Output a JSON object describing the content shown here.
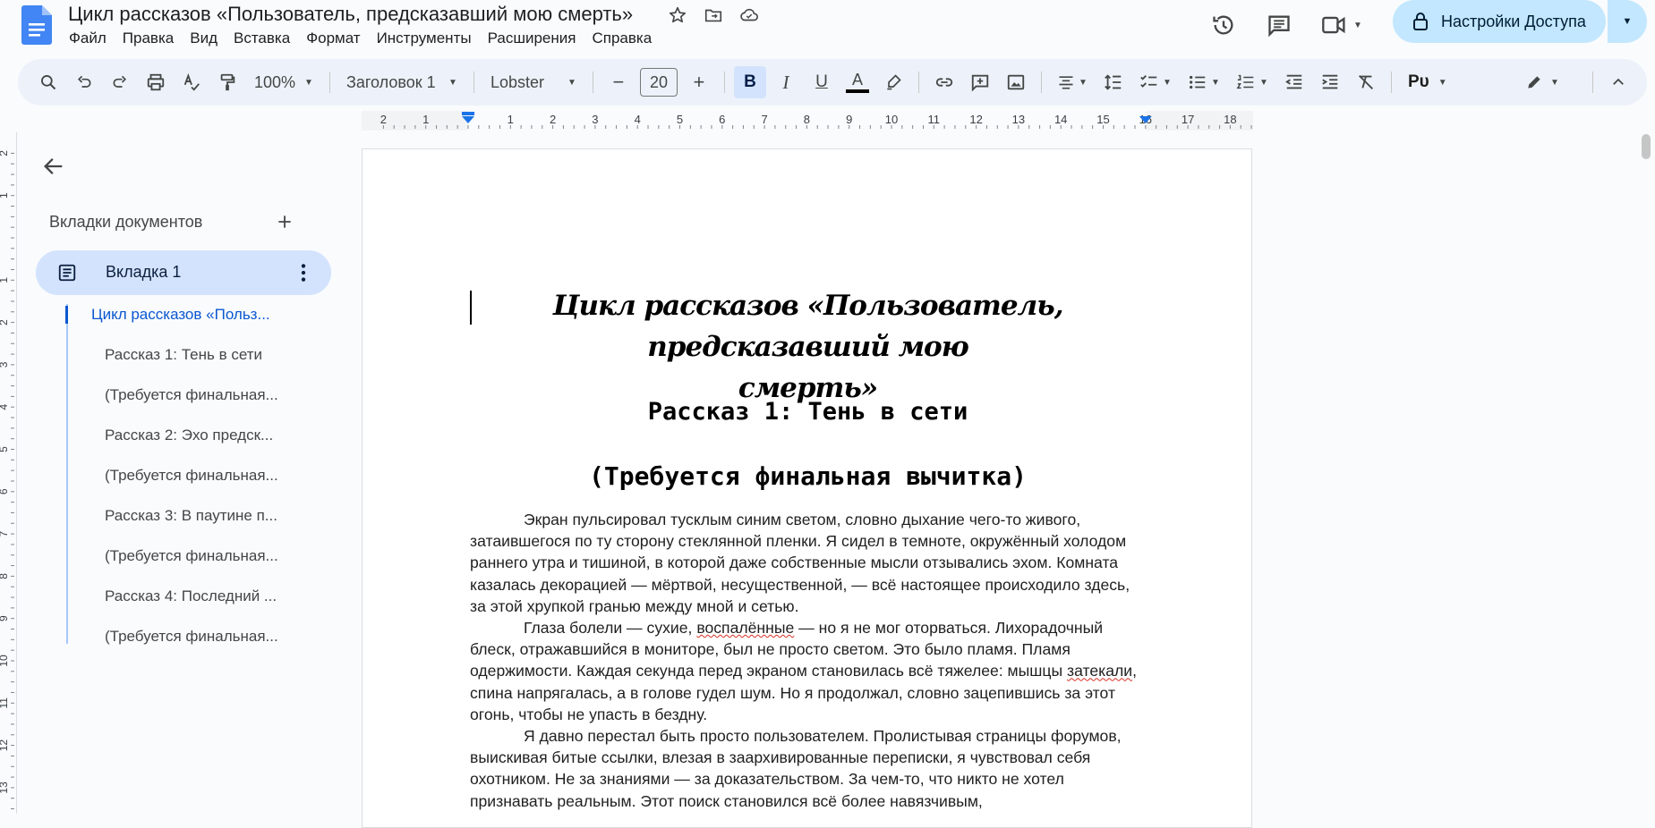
{
  "app": {
    "title": "Цикл рассказов «Пользователь, предсказавший мою смерть»"
  },
  "menu": [
    "Файл",
    "Правка",
    "Вид",
    "Вставка",
    "Формат",
    "Инструменты",
    "Расширения",
    "Справка"
  ],
  "share": {
    "label": "Настройки Доступа"
  },
  "toolbar": {
    "zoom": "100%",
    "style": "Заголовок 1",
    "font": "Lobster",
    "font_size": "20",
    "minus": "−",
    "plus": "+",
    "bold": "B",
    "italic": "I",
    "underline": "U",
    "text_color": "A",
    "input_tools": "Рᴜ"
  },
  "ruler": {
    "labels": [
      "2",
      "1",
      "1",
      "2",
      "3",
      "4",
      "5",
      "6",
      "7",
      "8",
      "9",
      "10",
      "11",
      "12",
      "13",
      "14",
      "15",
      "16",
      "17",
      "18"
    ],
    "vlabels": [
      "2",
      "1",
      "1",
      "2",
      "3",
      "4",
      "5",
      "6",
      "7",
      "8",
      "9",
      "10",
      "11",
      "12",
      "13"
    ]
  },
  "sidebar": {
    "heading": "Вкладки документов",
    "active_tab": "Вкладка 1",
    "outline": [
      "Цикл рассказов «Польз...",
      "Рассказ 1: Тень в сети",
      "(Требуется финальная...",
      "Рассказ 2: Эхо предск...",
      "(Требуется финальная...",
      "Рассказ 3: В паутине п...",
      "(Требуется финальная...",
      "Рассказ 4: Последний ...",
      "(Требуется финальная..."
    ]
  },
  "document": {
    "title_line1": "Цикл рассказов «Пользователь, предсказавший мою",
    "title_line2": "смерть»",
    "heading1": "Рассказ 1: Тень в сети",
    "heading2": "(Требуется финальная вычитка)",
    "p1": "Экран пульсировал тусклым синим светом, словно дыхание чего-то живого, затаившегося по ту сторону стеклянной пленки. Я сидел в темноте, окружённый холодом раннего утра и тишиной, в которой даже собственные мысли отзывались эхом. Комната казалась декорацией — мёртвой, несущественной, — всё настоящее происходило здесь, за этой хрупкой гранью между мной и сетью.",
    "p2_a": "Глаза болели — сухие, ",
    "p2_err1": "воспалённые",
    "p2_b": " — но я не мог оторваться. Лихорадочный блеск, отражавшийся в мониторе, был не просто светом. Это было пламя. Пламя одержимости. Каждая секунда перед экраном становилась всё тяжелее: мышцы ",
    "p2_err2": "затекали",
    "p2_c": ", спина напрягалась, а в голове гудел шум. Но я продолжал, словно зацепившись за этот огонь, чтобы не упасть в бездну.",
    "p3": "Я давно перестал быть просто пользователем. Пролистывая страницы форумов, выискивая битые ссылки, влезая в заархивированные переписки, я чувствовал себя охотником. Не за знаниями — за доказательством. За чем-то, что никто не хотел признавать реальным. Этот поиск становился всё более навязчивым,"
  }
}
